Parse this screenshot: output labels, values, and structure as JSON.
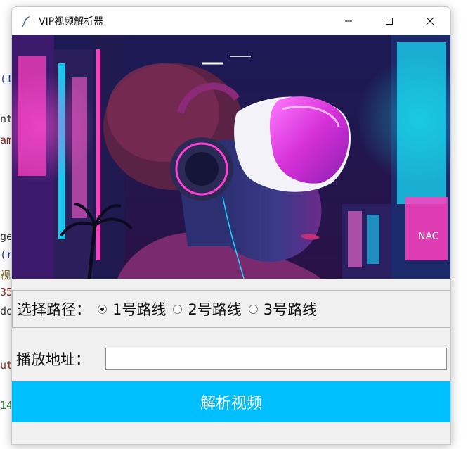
{
  "window": {
    "title": "VIP视频解析器",
    "controls": [
      "minimize",
      "maximize",
      "close"
    ]
  },
  "hero_image": {
    "alt": "Neon cyberpunk portrait wearing VR headset"
  },
  "routes": {
    "label": "选择路径：",
    "options": [
      "1号路线",
      "2号路线",
      "3号路线"
    ],
    "selected": "1号路线"
  },
  "play_url": {
    "label": "播放地址：",
    "value": "",
    "placeholder": ""
  },
  "parse_button": {
    "label": "解析视频"
  },
  "colors": {
    "accent": "#00bfff"
  }
}
